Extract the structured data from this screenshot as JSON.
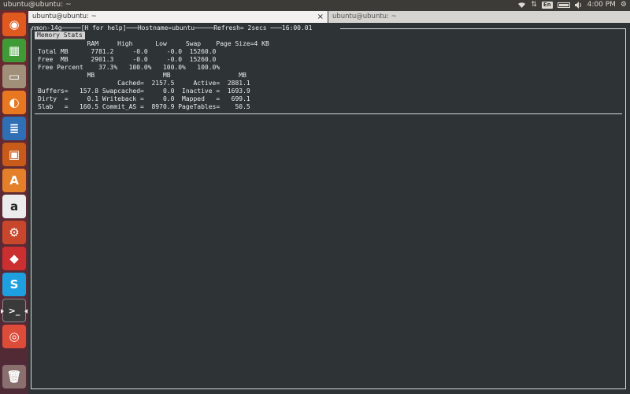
{
  "top_panel": {
    "window_title": "ubuntu@ubuntu: ~",
    "keyboard_layout": "En",
    "clock": "4:00 PM"
  },
  "launcher": {
    "items": [
      {
        "name": "dash-home",
        "label": "",
        "color": "#e05a1f",
        "glyph": "◉"
      },
      {
        "name": "libreoffice-calc",
        "label": "",
        "color": "#3f9b36",
        "glyph": "▦"
      },
      {
        "name": "files",
        "label": "",
        "color": "#a0907a",
        "glyph": "▭"
      },
      {
        "name": "firefox",
        "label": "",
        "color": "#e87722",
        "glyph": "◐"
      },
      {
        "name": "libreoffice-writer",
        "label": "",
        "color": "#2f6fb5",
        "glyph": "≣"
      },
      {
        "name": "libreoffice-impress",
        "label": "",
        "color": "#c85a1a",
        "glyph": "▣"
      },
      {
        "name": "software-center",
        "label": "",
        "color": "#e4802a",
        "glyph": "A"
      },
      {
        "name": "amazon",
        "label": "",
        "color": "#ececec",
        "glyph": "a"
      },
      {
        "name": "system-settings",
        "label": "",
        "color": "#c8472c",
        "glyph": "⚙"
      },
      {
        "name": "remmina",
        "label": "",
        "color": "#cc2f2f",
        "glyph": "◆"
      },
      {
        "name": "skype",
        "label": "",
        "color": "#1ea0e0",
        "glyph": "S"
      },
      {
        "name": "terminal",
        "label": "",
        "color": "#3a3a3a",
        "glyph": ">_"
      },
      {
        "name": "chrome",
        "label": "",
        "color": "#dd4b39",
        "glyph": "◎"
      },
      {
        "name": "trash",
        "label": "",
        "color": "#8a6f6f",
        "glyph": "🗑"
      }
    ]
  },
  "tabs": [
    {
      "label": "ubuntu@ubuntu: ~",
      "close": "×"
    },
    {
      "label": "ubuntu@ubuntu: ~"
    }
  ],
  "terminal": {
    "header": "nmon-14g─────[H for help]───Hostname=ubuntu─────Refresh= 2secs ───16:00.01",
    "section_title": "Memory Stats",
    "lines": [
      "             RAM     High      Low     Swap    Page Size=4 KB",
      "Total MB      7781.2     -0.0     -0.0  15260.0",
      "Free  MB      2901.3     -0.0     -0.0  15260.0",
      "Free Percent    37.3%   100.0%   100.0%   100.0%",
      "             MB                  MB                  MB",
      "                     Cached=  2157.5     Active=  2881.1",
      "Buffers=   157.8 Swapcached=     0.0  Inactive =  1693.9",
      "Dirty  =     0.1 Writeback =     0.0  Mapped   =   699.1",
      "Slab   =   160.5 Commit_AS =  8970.9 PageTables=    50.5"
    ]
  }
}
